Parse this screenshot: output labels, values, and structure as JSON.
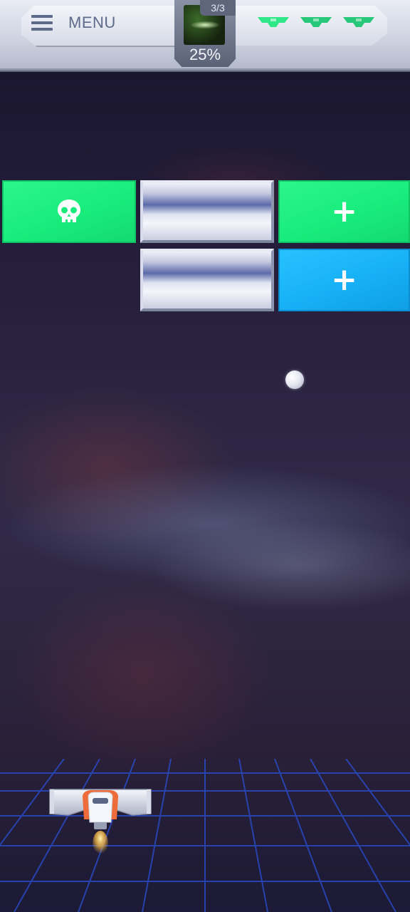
{
  "hud": {
    "menu_label": "MENU",
    "level_count": "3/3",
    "level_progress": "25%",
    "lives": [
      {
        "name": "life-indicator",
        "color": "#2ee887"
      },
      {
        "name": "life-indicator",
        "color": "#27c879"
      },
      {
        "name": "life-indicator",
        "color": "#27c879"
      }
    ]
  },
  "bricks": [
    {
      "type": "green",
      "symbol": "skull"
    },
    {
      "type": "metal",
      "symbol": "none"
    },
    {
      "type": "green",
      "symbol": "+"
    },
    {
      "type": "metal",
      "symbol": "none"
    },
    {
      "type": "blue",
      "symbol": "+"
    }
  ],
  "colors": {
    "brick_green": "#19ec7c",
    "brick_blue": "#17b0f6",
    "hud_text": "#5d6a8a",
    "grid_line": "#2a4fd4"
  },
  "icons": {
    "menu": "hamburger-icon",
    "skull": "skull-icon",
    "plus": "plus-icon",
    "paddle": "spaceship-paddle"
  }
}
